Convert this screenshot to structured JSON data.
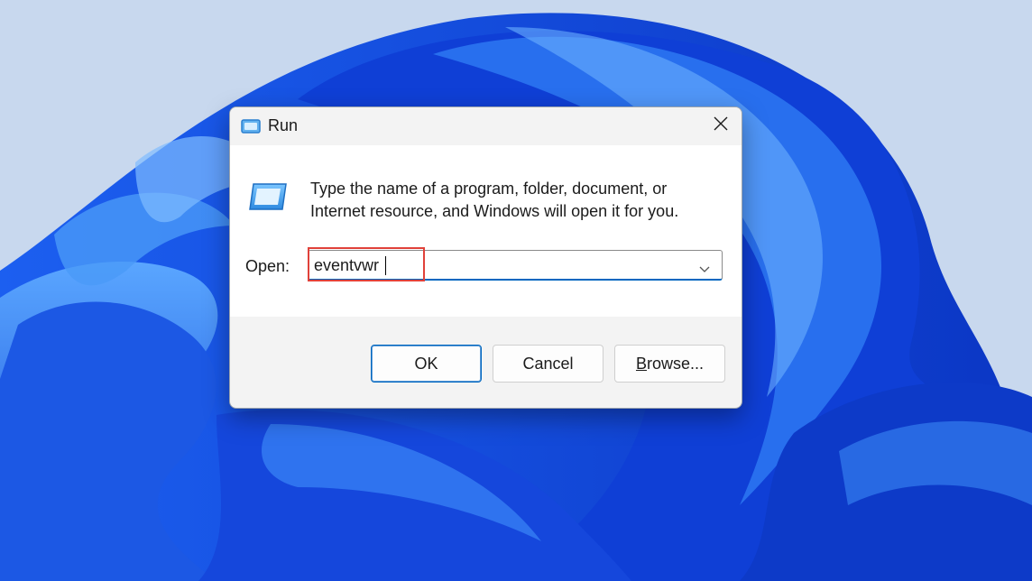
{
  "dialog": {
    "title": "Run",
    "description": "Type the name of a program, folder, document, or Internet resource, and Windows will open it for you.",
    "open_label": "Open:",
    "open_value": "eventvwr",
    "buttons": {
      "ok": "OK",
      "cancel": "Cancel",
      "browse_first": "B",
      "browse_rest": "rowse..."
    }
  },
  "icons": {
    "title": "run-icon",
    "close": "close-icon",
    "large": "run-icon",
    "dropdown": "chevron-down-icon"
  },
  "colors": {
    "accent": "#0067c0",
    "highlight": "#e0413a",
    "wallpaper_blue": "#1a56e0"
  }
}
